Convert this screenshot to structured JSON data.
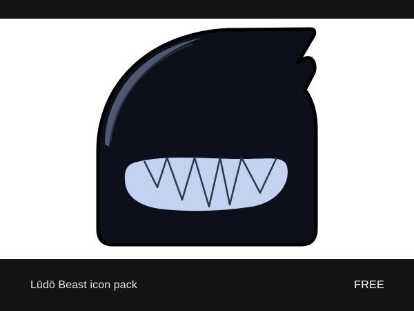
{
  "preview": {
    "icon_name": "ludo-beast-icon",
    "colors": {
      "background": "#ffffff",
      "body": "#0d101b",
      "outline": "#000000",
      "highlight": "#55617a",
      "mouth": "#c1d3f0",
      "teeth_lines": "#2b3648"
    }
  },
  "footer": {
    "title": "Lūdō Beast icon pack",
    "price": "FREE",
    "background": "#141414"
  }
}
